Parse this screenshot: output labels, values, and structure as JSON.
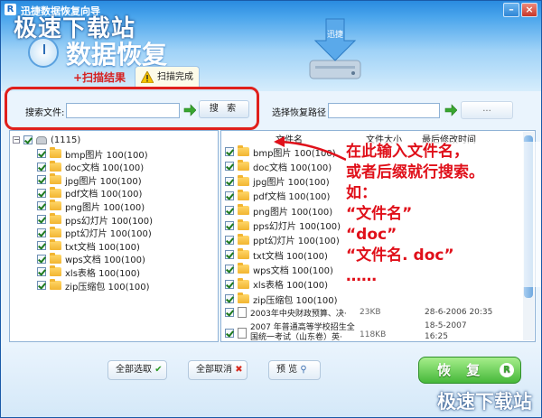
{
  "window": {
    "title": "迅捷数据恢复向导",
    "app_icon": "R",
    "minimize": "–",
    "close": "×"
  },
  "watermark": {
    "top": "极速下载站",
    "bottom": "极速下载站"
  },
  "brand": {
    "title": "数据恢复",
    "drive_label": "迅捷"
  },
  "tabs": {
    "scan_result": "+扫描结果",
    "scan_done": "扫描完成"
  },
  "search": {
    "file_label": "搜索文件:",
    "file_value": "",
    "search_button": "搜 索",
    "path_label": "选择恢复路径",
    "path_value": "",
    "browse_button": "..."
  },
  "tree": {
    "root": "(1115)",
    "items": [
      "bmp图片 100(100)",
      "doc文档 100(100)",
      "jpg图片 100(100)",
      "pdf文档 100(100)",
      "png图片 100(100)",
      "pps幻灯片 100(100)",
      "ppt幻灯片 100(100)",
      "txt文档 100(100)",
      "wps文档 100(100)",
      "xls表格 100(100)",
      "zip压缩包 100(100)"
    ]
  },
  "file_list": {
    "headers": {
      "name": "文件名",
      "size": "文件大小",
      "time": "最后修改时间"
    },
    "folders": [
      "bmp图片 100(100)",
      "doc文档 100(100)",
      "jpg图片 100(100)",
      "pdf文档 100(100)",
      "png图片 100(100)",
      "pps幻灯片 100(100)",
      "ppt幻灯片 100(100)",
      "txt文档 100(100)",
      "wps文档 100(100)",
      "xls表格 100(100)",
      "zip压缩包 100(100)"
    ],
    "files": [
      {
        "name": "2003年中央财政预算、决·",
        "size": "23KB",
        "time": "28-6-2006 20:35"
      },
      {
        "name_line1": "2007 年普通高等学校招生全",
        "name_line2": "国统一考试（山东卷）英·",
        "size": "118KB",
        "time_line1": "18-5-2007",
        "time_line2": "16:25"
      }
    ]
  },
  "annotation": {
    "lines": [
      "在此输入文件名，",
      "或者后缀就行搜索。",
      "如：",
      "“文件名”",
      "“doc”",
      "“文件名. doc”",
      "……"
    ]
  },
  "bottom": {
    "select_all": "全部选取",
    "deselect_all": "全部取消",
    "preview": "预  览",
    "recover": "恢 复",
    "recover_icon": "R"
  },
  "colors": {
    "accent": "#1c6ac4",
    "highlight": "#e0201c",
    "recover": "#46b83a"
  }
}
